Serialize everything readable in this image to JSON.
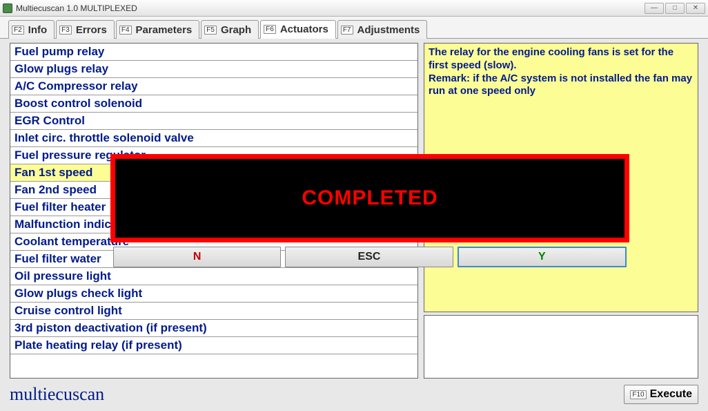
{
  "window": {
    "title": "Multiecuscan 1.0 MULTIPLEXED"
  },
  "tabs": [
    {
      "fkey": "F2",
      "label": "Info"
    },
    {
      "fkey": "F3",
      "label": "Errors"
    },
    {
      "fkey": "F4",
      "label": "Parameters"
    },
    {
      "fkey": "F5",
      "label": "Graph"
    },
    {
      "fkey": "F6",
      "label": "Actuators"
    },
    {
      "fkey": "F7",
      "label": "Adjustments"
    }
  ],
  "active_tab_index": 4,
  "list": {
    "items": [
      "Fuel pump relay",
      "Glow plugs relay",
      "A/C Compressor relay",
      "Boost control solenoid",
      "EGR Control",
      "Inlet circ. throttle solenoid valve",
      "Fuel pressure regulator",
      "Fan 1st speed",
      "Fan 2nd speed",
      "Fuel filter heater",
      "Malfunction indicator",
      "Coolant temperature",
      "Fuel filter water",
      "Oil pressure light",
      "Glow plugs check light",
      "Cruise control light",
      "3rd piston deactivation (if present)",
      "Plate heating relay (if present)"
    ],
    "selected_index": 7
  },
  "info": {
    "line1": "The relay for the engine cooling fans is set for the first speed (slow).",
    "line2": "Remark: if the A/C system is not installed the fan may run at one speed only"
  },
  "footer": {
    "brand": "multiecuscan",
    "execute_fkey": "F10",
    "execute_label": "Execute"
  },
  "dialog": {
    "message": "COMPLETED",
    "buttons": {
      "n": "N",
      "esc": "ESC",
      "y": "Y"
    }
  }
}
